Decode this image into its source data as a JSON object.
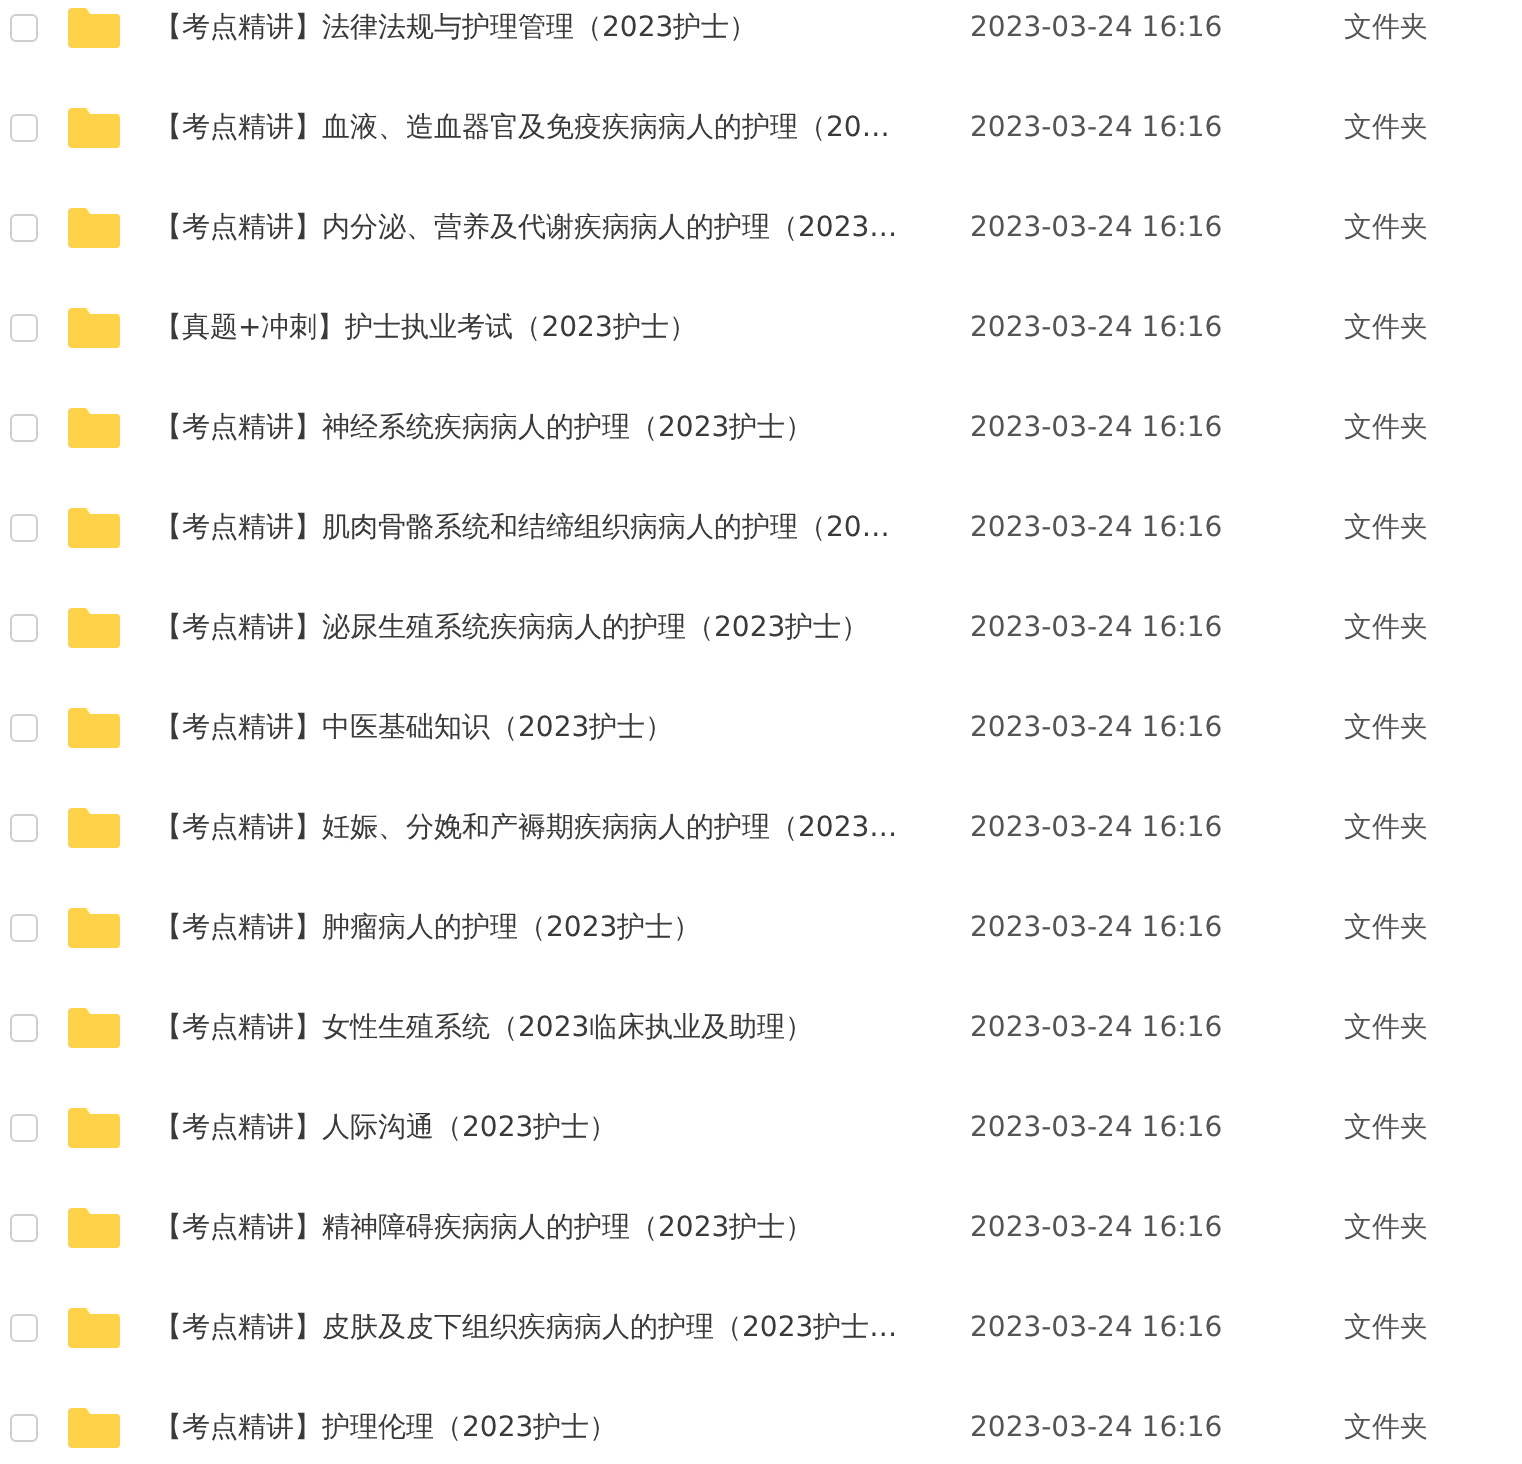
{
  "files": [
    {
      "name": "【考点精讲】法律法规与护理管理（2023护士）",
      "modified": "2023-03-24 16:16",
      "type": "文件夹",
      "checked": false
    },
    {
      "name": "【考点精讲】血液、造血器官及免疫疾病病人的护理（20…",
      "modified": "2023-03-24 16:16",
      "type": "文件夹",
      "checked": false
    },
    {
      "name": "【考点精讲】内分泌、营养及代谢疾病病人的护理（2023…",
      "modified": "2023-03-24 16:16",
      "type": "文件夹",
      "checked": false
    },
    {
      "name": "【真题+冲刺】护士执业考试（2023护士）",
      "modified": "2023-03-24 16:16",
      "type": "文件夹",
      "checked": false
    },
    {
      "name": "【考点精讲】神经系统疾病病人的护理（2023护士）",
      "modified": "2023-03-24 16:16",
      "type": "文件夹",
      "checked": false
    },
    {
      "name": "【考点精讲】肌肉骨骼系统和结缔组织病病人的护理（20…",
      "modified": "2023-03-24 16:16",
      "type": "文件夹",
      "checked": false
    },
    {
      "name": "【考点精讲】泌尿生殖系统疾病病人的护理（2023护士）",
      "modified": "2023-03-24 16:16",
      "type": "文件夹",
      "checked": false
    },
    {
      "name": "【考点精讲】中医基础知识（2023护士）",
      "modified": "2023-03-24 16:16",
      "type": "文件夹",
      "checked": false
    },
    {
      "name": "【考点精讲】妊娠、分娩和产褥期疾病病人的护理（2023…",
      "modified": "2023-03-24 16:16",
      "type": "文件夹",
      "checked": false
    },
    {
      "name": "【考点精讲】肿瘤病人的护理（2023护士）",
      "modified": "2023-03-24 16:16",
      "type": "文件夹",
      "checked": false
    },
    {
      "name": "【考点精讲】女性生殖系统（2023临床执业及助理）",
      "modified": "2023-03-24 16:16",
      "type": "文件夹",
      "checked": false
    },
    {
      "name": "【考点精讲】人际沟通（2023护士）",
      "modified": "2023-03-24 16:16",
      "type": "文件夹",
      "checked": false
    },
    {
      "name": "【考点精讲】精神障碍疾病病人的护理（2023护士）",
      "modified": "2023-03-24 16:16",
      "type": "文件夹",
      "checked": false
    },
    {
      "name": "【考点精讲】皮肤及皮下组织疾病病人的护理（2023护士…",
      "modified": "2023-03-24 16:16",
      "type": "文件夹",
      "checked": false
    },
    {
      "name": "【考点精讲】护理伦理（2023护士）",
      "modified": "2023-03-24 16:16",
      "type": "文件夹",
      "checked": false
    }
  ]
}
